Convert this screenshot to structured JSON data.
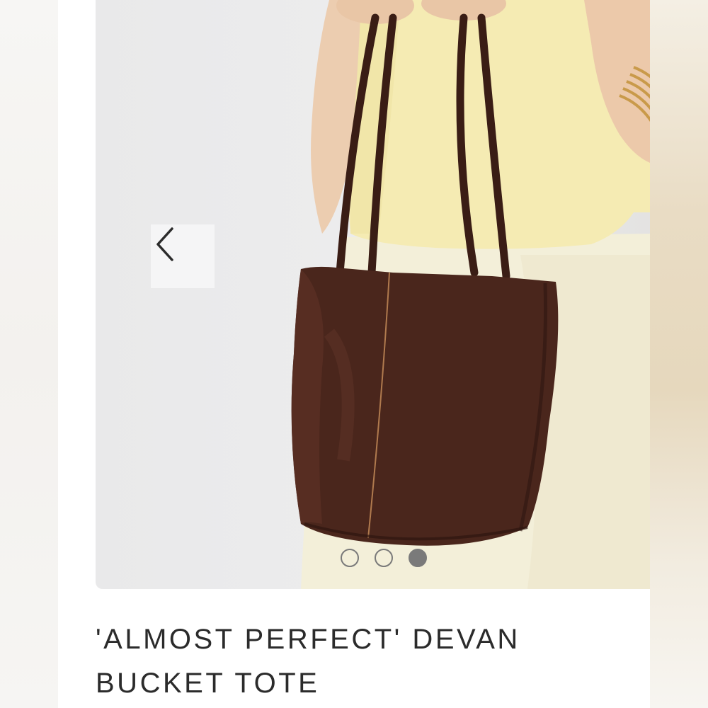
{
  "product": {
    "title_line1": "'ALMOST PERFECT' DEVAN",
    "title_line2": "BUCKET TOTE"
  },
  "carousel": {
    "prev_icon": "chevron-left-icon",
    "slide_count": 3,
    "active_slide": 3
  },
  "colors": {
    "photo_background": "#e9e9ea",
    "bag_leather": "#4a261c",
    "sweater": "#f4eab0",
    "skirt": "#f3efd8",
    "dot": "#7a7a7a",
    "title_text": "#2b2b2b"
  }
}
